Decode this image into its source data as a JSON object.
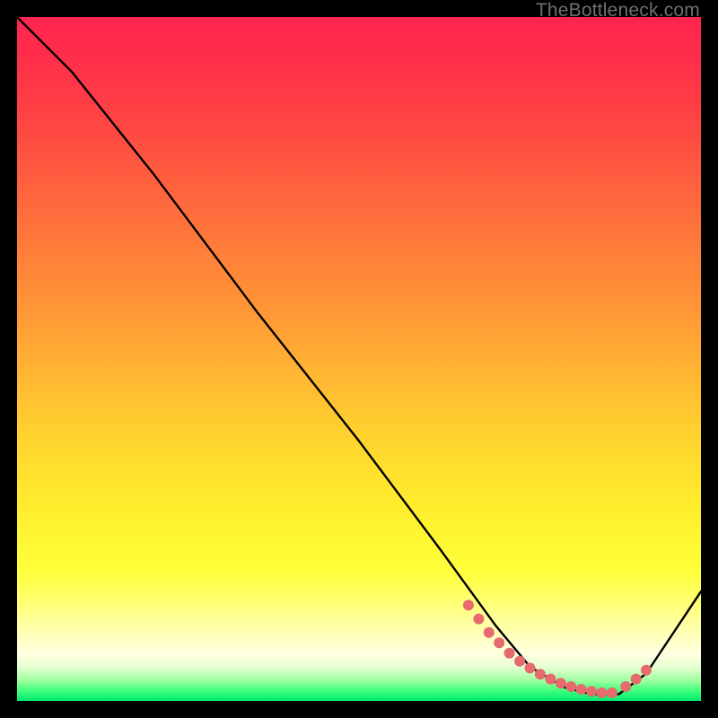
{
  "watermark": {
    "text": "TheBottleneck.com"
  },
  "chart_data": {
    "type": "line",
    "title": "",
    "xlabel": "",
    "ylabel": "",
    "xlim": [
      0,
      100
    ],
    "ylim": [
      0,
      100
    ],
    "grid": false,
    "legend": false,
    "note": "Axes are unlabeled; values are normalized 0–100 estimated from pixel positions.",
    "series": [
      {
        "name": "curve",
        "x": [
          0,
          8,
          20,
          35,
          50,
          62,
          70,
          75,
          80,
          84,
          88,
          92,
          100
        ],
        "y": [
          100,
          92,
          77,
          57,
          38,
          22,
          11,
          5,
          2,
          1,
          1,
          4,
          16
        ]
      }
    ],
    "markers": {
      "name": "highlight-dots",
      "note": "Salmon/coral dotted segment near the valley bottom-right.",
      "x": [
        66,
        67.5,
        69,
        70.5,
        72,
        73.5,
        75,
        76.5,
        78,
        79.5,
        81,
        82.5,
        84,
        85.5,
        87,
        89,
        90.5,
        92
      ],
      "y": [
        14,
        12,
        10,
        8.5,
        7,
        5.8,
        4.8,
        3.9,
        3.2,
        2.6,
        2.1,
        1.7,
        1.4,
        1.2,
        1.2,
        2.1,
        3.2,
        4.5
      ]
    },
    "colors": {
      "curve_stroke": "#000000",
      "marker_fill": "#e76a6f",
      "gradient_top": "#ff2550",
      "gradient_mid": "#ffee2d",
      "gradient_bottom": "#00e86e"
    }
  }
}
